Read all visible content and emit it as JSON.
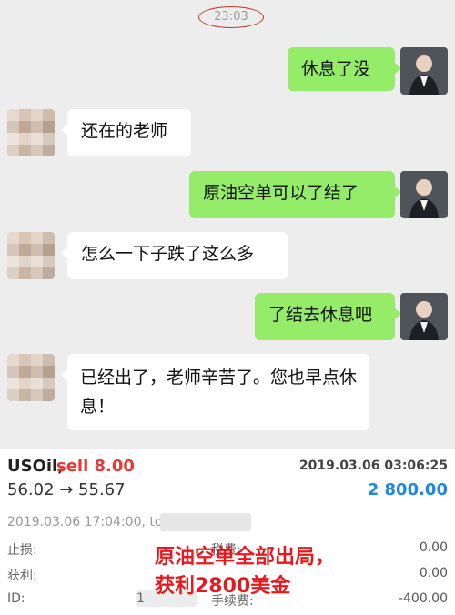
{
  "chat": {
    "time": "23:03",
    "messages": [
      {
        "from": "me",
        "text": "休息了没"
      },
      {
        "from": "other",
        "text": "还在的老师"
      },
      {
        "from": "me",
        "text": "原油空单可以了结了"
      },
      {
        "from": "other",
        "text": "怎么一下子跌了这么多"
      },
      {
        "from": "me",
        "text": "了结去休息吧"
      },
      {
        "from": "other",
        "text": "已经出了，老师辛苦了。您也早点休息！"
      }
    ]
  },
  "order": {
    "symbol": "USOil,",
    "side": "sell 8.00",
    "close_datetime": "2019.03.06 03:06:25",
    "price_change": "56.02 → 55.67",
    "profit": "2 800.00",
    "open_datetime": "2019.03.06 17:04:00, to",
    "rows": [
      {
        "label": "止损:",
        "value": "0.00"
      },
      {
        "label": "获利:",
        "value": "0.00"
      },
      {
        "label": "ID:",
        "value": "1"
      }
    ],
    "tax_label": "税费:",
    "fee_label": "手续费:",
    "fee_value": "-400.00"
  },
  "annotation": {
    "line1": "原油空单全部出局，",
    "line2": "获利2800美金"
  },
  "colors": {
    "my_bubble": "#95ec69",
    "sell": "#e53935",
    "profit": "#1e88e5",
    "annotation": "#e8191e"
  }
}
